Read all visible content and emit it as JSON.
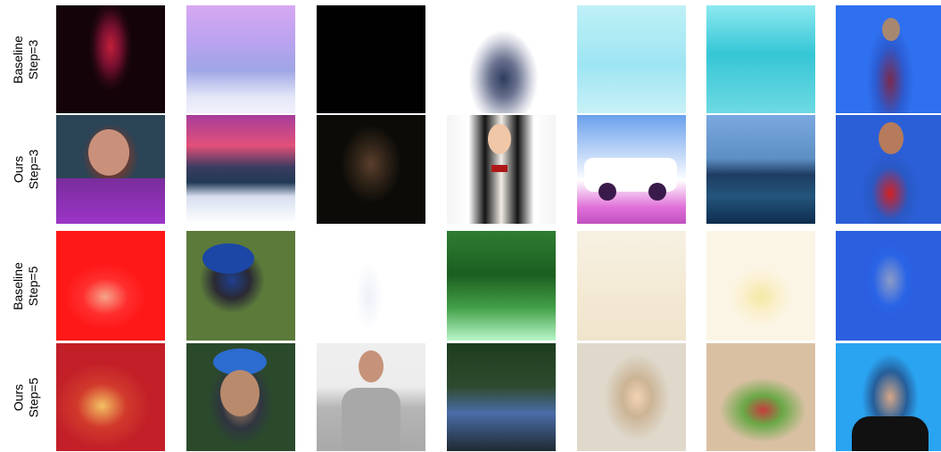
{
  "rows": [
    {
      "line1": "Baseline",
      "line2": "Step=3"
    },
    {
      "line1": "Ours",
      "line2": "Step=3"
    },
    {
      "line1": "Baseline",
      "line2": "Step=5"
    },
    {
      "line1": "Ours",
      "line2": "Step=5"
    }
  ]
}
